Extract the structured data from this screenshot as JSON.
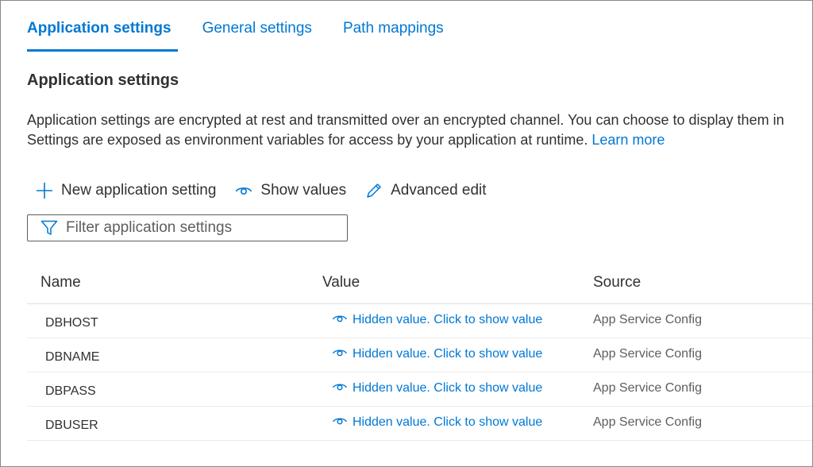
{
  "tabs": [
    {
      "label": "Application settings",
      "active": true
    },
    {
      "label": "General settings",
      "active": false
    },
    {
      "label": "Path mappings",
      "active": false
    }
  ],
  "section": {
    "title": "Application settings",
    "description_line1": "Application settings are encrypted at rest and transmitted over an encrypted channel. You can choose to display them in",
    "description_line2": "Settings are exposed as environment variables for access by your application at runtime.",
    "learn_more": "Learn more"
  },
  "toolbar": {
    "new_setting": "New application setting",
    "show_values": "Show values",
    "advanced_edit": "Advanced edit"
  },
  "filter": {
    "placeholder": "Filter application settings",
    "value": ""
  },
  "table": {
    "headers": {
      "name": "Name",
      "value": "Value",
      "source": "Source"
    },
    "rows": [
      {
        "name": "DBHOST",
        "value": "Hidden value. Click to show value",
        "source": "App Service Config"
      },
      {
        "name": "DBNAME",
        "value": "Hidden value. Click to show value",
        "source": "App Service Config"
      },
      {
        "name": "DBPASS",
        "value": "Hidden value. Click to show value",
        "source": "App Service Config"
      },
      {
        "name": "DBUSER",
        "value": "Hidden value. Click to show value",
        "source": "App Service Config"
      }
    ]
  },
  "colors": {
    "accent": "#0078d4",
    "text": "#323130",
    "muted": "#605e5c"
  }
}
